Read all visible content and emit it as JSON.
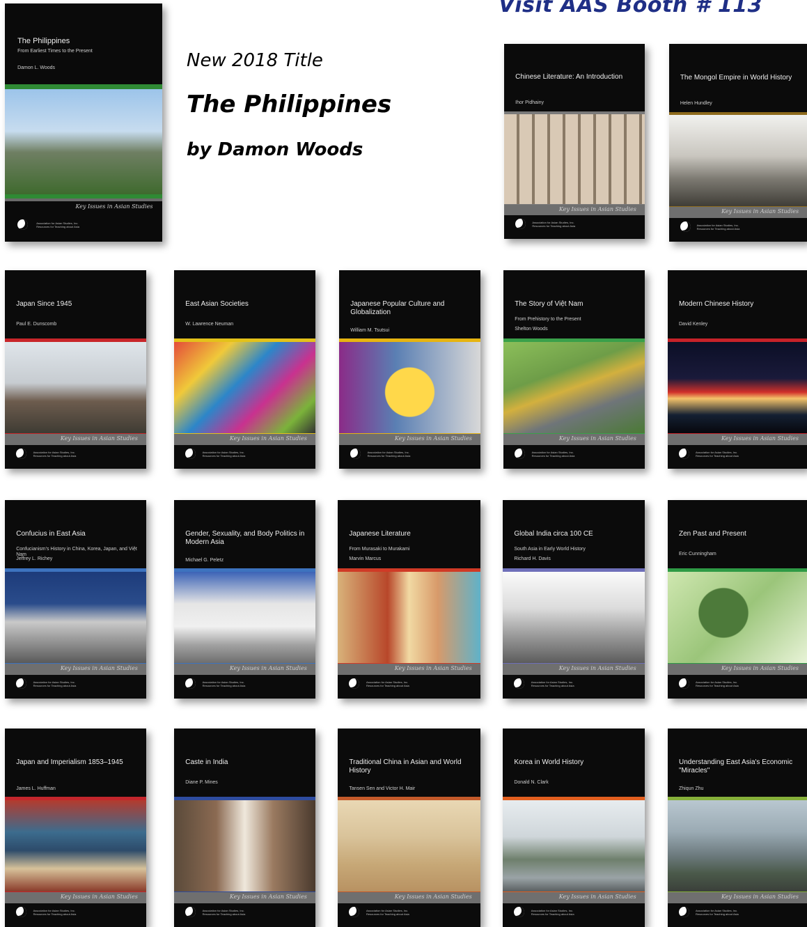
{
  "banner": {
    "visit_text": "Visit AAS Booth # 113"
  },
  "promo": {
    "tag": "New 2018 Title",
    "title": "The Philippines",
    "byline": "by Damon Woods"
  },
  "series_name": "Key Issues in Asian Studies",
  "publisher": {
    "line1": "Association for Asian Studies, Inc.",
    "line2": "Resources for Teaching about Asia"
  },
  "books": [
    {
      "title": "The Philippines",
      "subtitle": "From Earliest Times to the Present",
      "author": "Damon L. Woods",
      "accent": "#2f8a34",
      "image": "volcano-and-bell-tower"
    },
    {
      "title": "Chinese Literature: An Introduction",
      "subtitle": "",
      "author": "Ihor Pidhainy",
      "accent": "#7a7a7a",
      "image": "portrait-collage"
    },
    {
      "title": "The Mongol Empire in World History",
      "subtitle": "",
      "author": "Helen Hundley",
      "accent": "#8d6a1c",
      "image": "genghis-khan-statue"
    },
    {
      "title": "Japan Since 1945",
      "subtitle": "",
      "author": "Paul E. Dunscomb",
      "accent": "#c8262a",
      "image": "tokyo-tower-temple"
    },
    {
      "title": "East Asian Societies",
      "subtitle": "",
      "author": "W. Lawrence Neuman",
      "accent": "#e3c21a",
      "image": "umbrellas-street"
    },
    {
      "title": "Japanese Popular Culture and Globalization",
      "subtitle": "",
      "author": "William M. Tsutsui",
      "accent": "#e6b411",
      "image": "pikachu-balloon"
    },
    {
      "title": "The Story of Việt Nam",
      "subtitle": "From Prehistory to the Present",
      "author": "Shelton Woods",
      "accent": "#3aa04a",
      "image": "rice-drying-road"
    },
    {
      "title": "Modern Chinese History",
      "subtitle": "",
      "author": "David Kenley",
      "accent": "#c62229",
      "image": "birds-nest-stadium"
    },
    {
      "title": "Confucius in East Asia",
      "subtitle": "Confucianism's History in China, Korea, Japan, and Việt Nam",
      "author": "Jeffrey L. Richey",
      "accent": "#3d73bf",
      "image": "confucius-statue"
    },
    {
      "title": "Gender, Sexuality, and Body Politics in Modern Asia",
      "subtitle": "",
      "author": "Michael G. Peletz",
      "accent": "#3d73bf",
      "image": "billboard-cyclist"
    },
    {
      "title": "Japanese Literature",
      "subtitle": "From Murasaki to Murakami",
      "author": "Marvin Marcus",
      "accent": "#d03a26",
      "image": "ukiyo-e-and-goggles"
    },
    {
      "title": "Global India circa 100 CE",
      "subtitle": "South Asia in Early World History",
      "author": "Richard H. Davis",
      "accent": "#6e6fb9",
      "image": "buddha-sculpture"
    },
    {
      "title": "Zen Past and Present",
      "subtitle": "",
      "author": "Eric Cunningham",
      "accent": "#2e9a45",
      "image": "buddha-head-green"
    },
    {
      "title": "Japan and Imperialism 1853–1945",
      "subtitle": "",
      "author": "James L. Huffman",
      "accent": "#c3262c",
      "image": "woodblock-battle"
    },
    {
      "title": "Caste in India",
      "subtitle": "",
      "author": "Diane P. Mines",
      "accent": "#2e4c9f",
      "image": "man-and-child"
    },
    {
      "title": "Traditional China in Asian and World History",
      "subtitle": "",
      "author": "Tansen Sen and Victor H. Mair",
      "accent": "#c45a2a",
      "image": "scroll-painting"
    },
    {
      "title": "Korea in World History",
      "subtitle": "",
      "author": "Donald N. Clark",
      "accent": "#e25f1f",
      "image": "admiral-statue-seoul"
    },
    {
      "title": "Understanding East Asia's Economic \"Miracles\"",
      "subtitle": "",
      "author": "Zhiqun Zhu",
      "accent": "#86b03a",
      "image": "shanghai-skyline"
    }
  ]
}
